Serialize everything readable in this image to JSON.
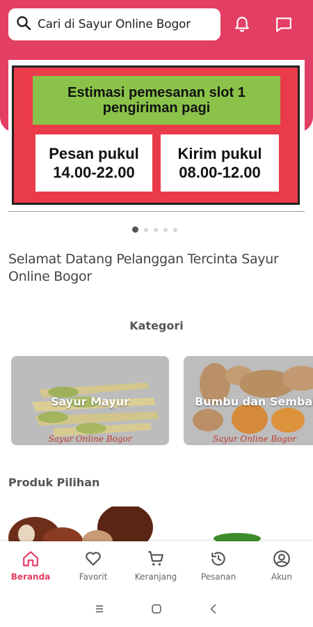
{
  "search": {
    "placeholder": "Cari di Sayur Online Bogor"
  },
  "header": {
    "icons": [
      "bell-icon",
      "chat-icon"
    ],
    "accent_color": "#e33e63"
  },
  "banner": {
    "title": "Estimasi pemesanan slot 1 pengiriman pagi",
    "order_box": "Pesan pukul 14.00-22.00",
    "delivery_box": "Kirim pukul 08.00-12.00",
    "colors": {
      "background": "#ea3b4a",
      "title_bg": "#8bc34a"
    },
    "carousel": {
      "total": 5,
      "active_index": 0
    }
  },
  "welcome_text": "Selamat Datang Pelanggan Tercinta Sayur Online Bogor",
  "categories": {
    "title": "Kategori",
    "items": [
      {
        "label": "Sayur Mayur",
        "watermark": "Sayur Online Bogor"
      },
      {
        "label": "Bumbu dan Sembako",
        "watermark": "Sayur Online Bogor"
      }
    ]
  },
  "products": {
    "title": "Produk Pilihan"
  },
  "bottom_nav": {
    "items": [
      {
        "label": "Beranda",
        "icon": "home-icon",
        "active": true
      },
      {
        "label": "Favorit",
        "icon": "heart-icon",
        "active": false
      },
      {
        "label": "Keranjang",
        "icon": "cart-icon",
        "active": false
      },
      {
        "label": "Pesanan",
        "icon": "history-icon",
        "active": false
      },
      {
        "label": "Akun",
        "icon": "account-icon",
        "active": false
      }
    ]
  },
  "system_nav": {
    "icons": [
      "recents-icon",
      "home-button-icon",
      "back-icon"
    ]
  }
}
